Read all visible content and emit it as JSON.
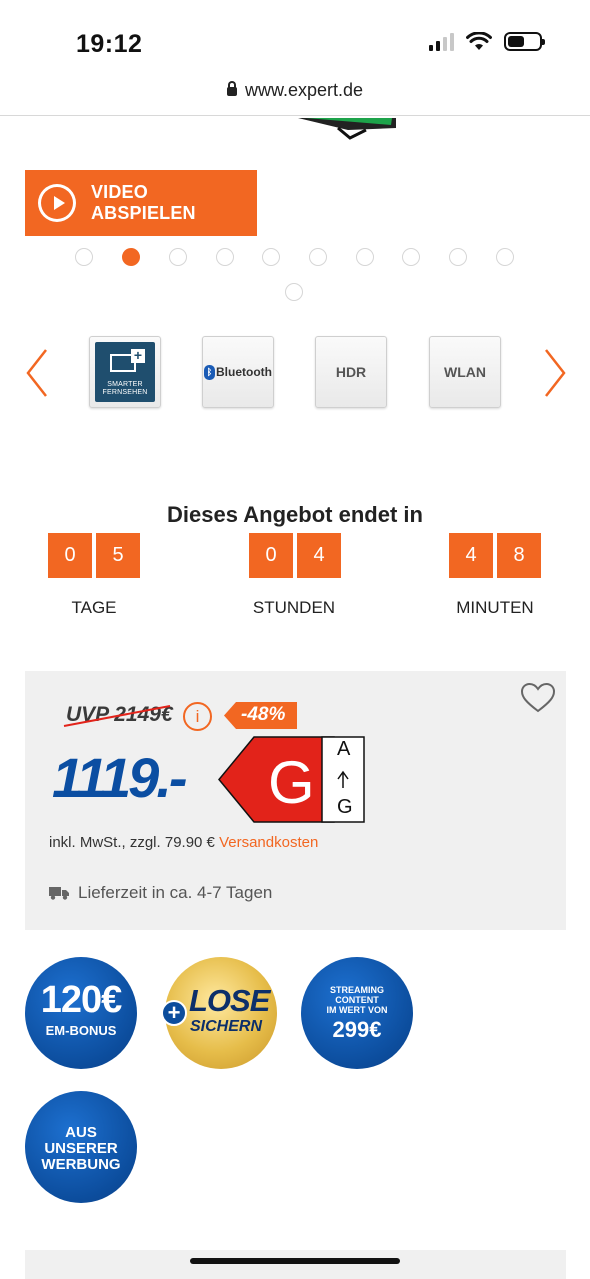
{
  "status_bar": {
    "time": "19:12"
  },
  "browser": {
    "url": "www.expert.de"
  },
  "media": {
    "video_button_label": "VIDEO ABSPIELEN",
    "slide_count": 11,
    "active_slide": 2
  },
  "features": [
    {
      "name": "smart-tv",
      "label": "SMARTER FERNSEHEN"
    },
    {
      "name": "bluetooth",
      "label": "Bluetooth"
    },
    {
      "name": "hdr",
      "label": "HDR"
    },
    {
      "name": "wlan",
      "label": "WLAN"
    }
  ],
  "countdown": {
    "title": "Dieses Angebot endet in",
    "days": [
      "0",
      "5"
    ],
    "hours": [
      "0",
      "4"
    ],
    "minutes": [
      "4",
      "8"
    ],
    "days_label": "TAGE",
    "hours_label": "STUNDEN",
    "minutes_label": "MINUTEN"
  },
  "price": {
    "uvp": "UVP 2149€",
    "info_symbol": "i",
    "discount": "-48%",
    "current": "1119.-",
    "energy_class": "G",
    "energy_scale_top": "A",
    "energy_scale_bottom": "G",
    "tax_note": "inkl. MwSt., zzgl. 79.90 € ",
    "shipping_link": "Versandkosten",
    "delivery": "Lieferzeit in ca. 4-7 Tagen"
  },
  "badges": {
    "bonus_value": "120€",
    "bonus_label": "EM-BONUS",
    "lose_line1": "LOSE",
    "lose_line2": "SICHERN",
    "lose_plus": "+",
    "stream_line1": "STREAMING",
    "stream_line2": "CONTENT",
    "stream_line3": "IM WERT VON",
    "stream_value": "299€",
    "ad_line1": "AUS",
    "ad_line2": "UNSERER",
    "ad_line3": "WERBUNG"
  },
  "colors": {
    "accent": "#f26722",
    "brand_blue": "#0b4ea2",
    "panel": "#f0f0f0"
  }
}
